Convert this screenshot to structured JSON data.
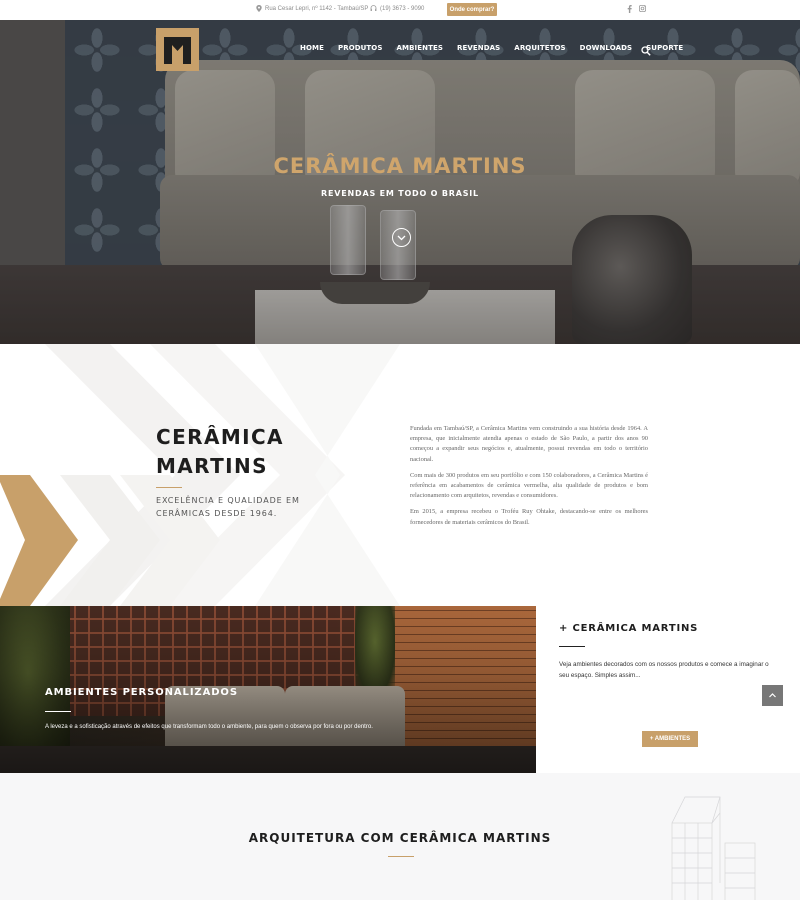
{
  "topbar": {
    "address": "Rua Cesar Lepri, nº 1142 - Tambaú/SP",
    "phone": "(19) 3673 - 9090",
    "cta_label": "Onde comprar?",
    "social": [
      "facebook-icon",
      "instagram-icon"
    ]
  },
  "nav": {
    "items": [
      "HOME",
      "PRODUTOS",
      "AMBIENTES",
      "REVENDAS",
      "ARQUITETOS",
      "DOWNLOADS",
      "SUPORTE"
    ]
  },
  "hero": {
    "title": "CERÂMICA MARTINS",
    "subtitle": "REVENDAS EM TODO O BRASIL"
  },
  "about": {
    "title_line1": "CERÂMICA",
    "title_line2": "MARTINS",
    "subtitle": "EXCELÊNCIA E QUALIDADE EM CERÂMICAS DESDE 1964.",
    "paragraphs": [
      "Fundada em Tambaú/SP, a Cerâmica Martins vem construindo a sua história desde 1964. A empresa, que inicialmente atendia apenas o estado de São Paulo, a partir dos anos 90 começou a expandir seus negócios e, atualmente, possui revendas em todo o território nacional.",
      "Com mais de 300 produtos em seu portfólio e com 150 colaboradores, a Cerâmica Martins é referência em acabamentos de cerâmica vermelha, alta qualidade de produtos e bom relacionamento com arquitetos, revendas e consumidores.",
      "Em 2015, a empresa recebeu o Troféu Ruy Ohtake, destacando-se entre os melhores fornecedores de materiais cerâmicos do Brasil."
    ]
  },
  "ambientes": {
    "title": "AMBIENTES PERSONALIZADOS",
    "description": "A leveza e a sofisticação através de efeitos que transformam todo o ambiente, para quem o observa por fora ou por dentro.",
    "side_title": "+ CERÂMICA MARTINS",
    "side_text": "Veja ambientes decorados com os nossos produtos e comece a imaginar o seu espaço. Simples assim...",
    "button_label": "+ AMBIENTES"
  },
  "arquitetura": {
    "title": "ARQUITETURA COM CERÂMICA MARTINS"
  },
  "colors": {
    "gold": "#c8a06a",
    "dark": "#1e1e1e"
  }
}
